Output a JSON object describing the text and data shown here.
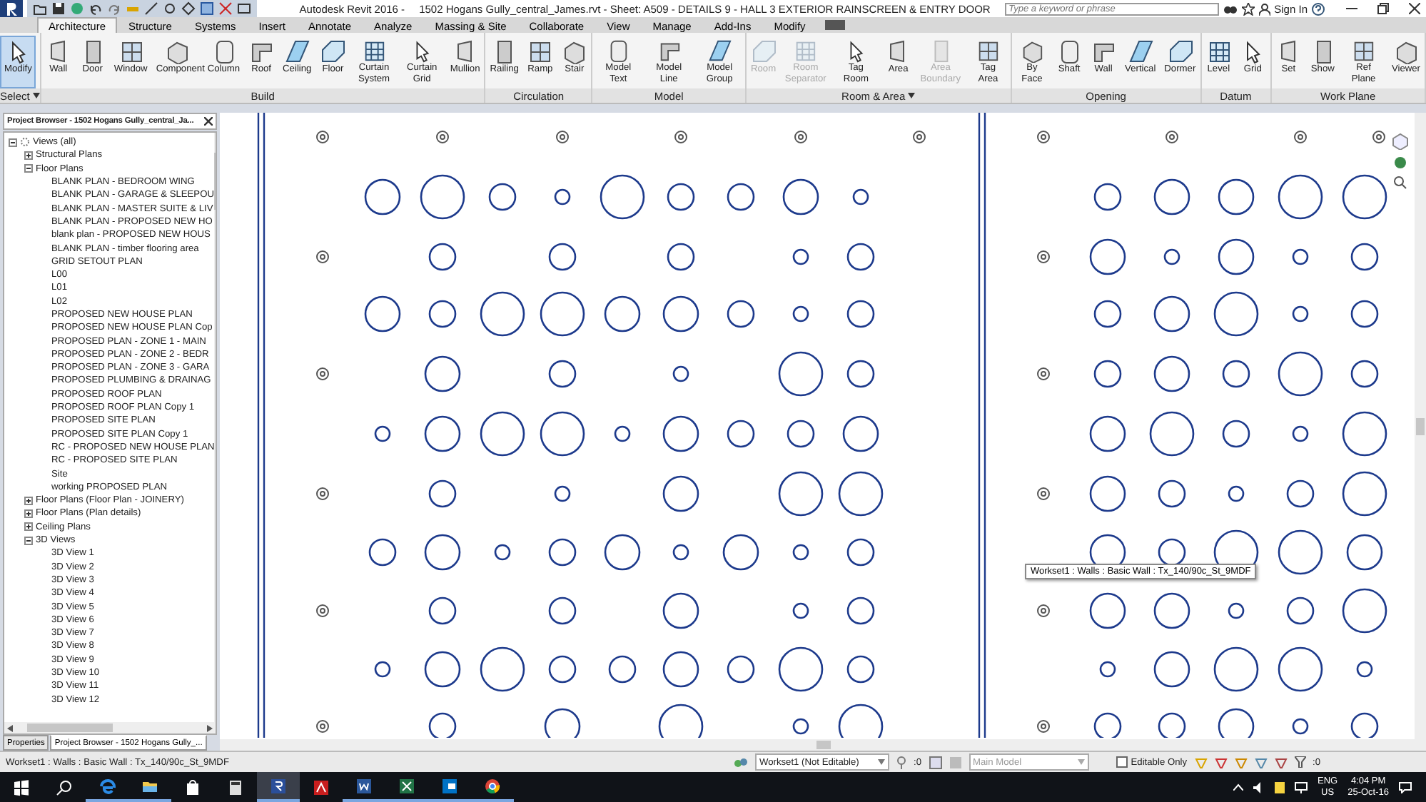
{
  "window": {
    "title": "Autodesk Revit 2016 -",
    "document": "1502 Hogans Gully_central_James.rvt - Sheet: A509 - DETAILS 9 - HALL 3 EXTERIOR RAINSCREEN & ENTRY DOOR",
    "search": {
      "placeholder": "Type a keyword or phrase"
    },
    "sign_in": "Sign In"
  },
  "ribbon": {
    "tabs": [
      {
        "label": "Architecture",
        "selected": true
      },
      {
        "label": "Structure",
        "selected": false
      },
      {
        "label": "Systems",
        "selected": false
      },
      {
        "label": "Insert",
        "selected": false
      },
      {
        "label": "Annotate",
        "selected": false
      },
      {
        "label": "Analyze",
        "selected": false
      },
      {
        "label": "Massing & Site",
        "selected": false
      },
      {
        "label": "Collaborate",
        "selected": false
      },
      {
        "label": "View",
        "selected": false
      },
      {
        "label": "Manage",
        "selected": false
      },
      {
        "label": "Add-Ins",
        "selected": false
      },
      {
        "label": "Modify",
        "selected": false
      }
    ],
    "panels": [
      {
        "label": "Select",
        "menu": true,
        "tools": [
          {
            "label": "Modify",
            "selected": true,
            "disabled": false
          }
        ]
      },
      {
        "label": "Build",
        "menu": false,
        "tools": [
          {
            "label": "Wall",
            "selected": false,
            "disabled": false
          },
          {
            "label": "Door",
            "selected": false,
            "disabled": false
          },
          {
            "label": "Window",
            "selected": false,
            "disabled": false
          },
          {
            "label": "Component",
            "selected": false,
            "disabled": false
          },
          {
            "label": "Column",
            "selected": false,
            "disabled": false
          },
          {
            "label": "Roof",
            "selected": false,
            "disabled": false
          },
          {
            "label": "Ceiling",
            "selected": false,
            "disabled": false
          },
          {
            "label": "Floor",
            "selected": false,
            "disabled": false
          },
          {
            "label": "Curtain System",
            "selected": false,
            "disabled": false
          },
          {
            "label": "Curtain Grid",
            "selected": false,
            "disabled": false
          },
          {
            "label": "Mullion",
            "selected": false,
            "disabled": false
          }
        ]
      },
      {
        "label": "Circulation",
        "menu": false,
        "tools": [
          {
            "label": "Railing",
            "selected": false,
            "disabled": false
          },
          {
            "label": "Ramp",
            "selected": false,
            "disabled": false
          },
          {
            "label": "Stair",
            "selected": false,
            "disabled": false
          }
        ]
      },
      {
        "label": "Model",
        "menu": false,
        "tools": [
          {
            "label": "Model Text",
            "selected": false,
            "disabled": false
          },
          {
            "label": "Model Line",
            "selected": false,
            "disabled": false
          },
          {
            "label": "Model Group",
            "selected": false,
            "disabled": false
          }
        ]
      },
      {
        "label": "Room & Area",
        "menu": true,
        "tools": [
          {
            "label": "Room",
            "selected": false,
            "disabled": true
          },
          {
            "label": "Room Separator",
            "selected": false,
            "disabled": true
          },
          {
            "label": "Tag Room",
            "selected": false,
            "disabled": false
          },
          {
            "label": "Area",
            "selected": false,
            "disabled": false
          },
          {
            "label": "Area Boundary",
            "selected": false,
            "disabled": true
          },
          {
            "label": "Tag Area",
            "selected": false,
            "disabled": false
          }
        ]
      },
      {
        "label": "Opening",
        "menu": false,
        "tools": [
          {
            "label": "By Face",
            "selected": false,
            "disabled": false
          },
          {
            "label": "Shaft",
            "selected": false,
            "disabled": false
          },
          {
            "label": "Wall",
            "selected": false,
            "disabled": false
          },
          {
            "label": "Vertical",
            "selected": false,
            "disabled": false
          },
          {
            "label": "Dormer",
            "selected": false,
            "disabled": false
          }
        ]
      },
      {
        "label": "Datum",
        "menu": false,
        "tools": [
          {
            "label": "Level",
            "selected": false,
            "disabled": false
          },
          {
            "label": "Grid",
            "selected": false,
            "disabled": false
          }
        ]
      },
      {
        "label": "Work Plane",
        "menu": false,
        "tools": [
          {
            "label": "Set",
            "selected": false,
            "disabled": false
          },
          {
            "label": "Show",
            "selected": false,
            "disabled": false
          },
          {
            "label": "Ref Plane",
            "selected": false,
            "disabled": false
          },
          {
            "label": "Viewer",
            "selected": false,
            "disabled": false
          }
        ]
      }
    ]
  },
  "project_browser": {
    "title": "Project Browser - 1502 Hogans Gully_central_Ja...",
    "tree": [
      {
        "label": "Views (all)",
        "expanded": true,
        "children": [
          {
            "label": "Structural Plans",
            "expanded": false
          },
          {
            "label": "Floor Plans",
            "expanded": true,
            "children": [
              {
                "label": "BLANK PLAN - BEDROOM WING"
              },
              {
                "label": "BLANK PLAN - GARAGE & SLEEPOU"
              },
              {
                "label": "BLANK PLAN - MASTER SUITE & LIV"
              },
              {
                "label": "BLANK PLAN - PROPOSED NEW HO"
              },
              {
                "label": "blank plan - PROPOSED NEW HOUS"
              },
              {
                "label": "BLANK PLAN - timber flooring area"
              },
              {
                "label": "GRID SETOUT PLAN"
              },
              {
                "label": "L00"
              },
              {
                "label": "L01"
              },
              {
                "label": "L02"
              },
              {
                "label": "PROPOSED NEW HOUSE PLAN"
              },
              {
                "label": "PROPOSED NEW HOUSE PLAN Cop"
              },
              {
                "label": "PROPOSED PLAN - ZONE 1 - MAIN"
              },
              {
                "label": "PROPOSED PLAN - ZONE 2 - BEDR"
              },
              {
                "label": "PROPOSED PLAN - ZONE 3 - GARA"
              },
              {
                "label": "PROPOSED PLUMBING & DRAINAG"
              },
              {
                "label": "PROPOSED ROOF PLAN"
              },
              {
                "label": "PROPOSED ROOF PLAN Copy 1"
              },
              {
                "label": "PROPOSED SITE PLAN"
              },
              {
                "label": "PROPOSED SITE PLAN Copy 1"
              },
              {
                "label": "RC - PROPOSED NEW HOUSE PLAN"
              },
              {
                "label": "RC - PROPOSED SITE PLAN"
              },
              {
                "label": "Site"
              },
              {
                "label": "working PROPOSED PLAN"
              }
            ]
          },
          {
            "label": "Floor Plans (Floor Plan - JOINERY)",
            "expanded": false
          },
          {
            "label": "Floor Plans (Plan details)",
            "expanded": false
          },
          {
            "label": "Ceiling Plans",
            "expanded": false
          },
          {
            "label": "3D Views",
            "expanded": true,
            "children": [
              {
                "label": "3D View 1"
              },
              {
                "label": "3D View 2"
              },
              {
                "label": "3D View 3"
              },
              {
                "label": "3D View 4"
              },
              {
                "label": "3D View 5"
              },
              {
                "label": "3D View 6"
              },
              {
                "label": "3D View 7"
              },
              {
                "label": "3D View 8"
              },
              {
                "label": "3D View 9"
              },
              {
                "label": "3D View 10"
              },
              {
                "label": "3D View 11"
              },
              {
                "label": "3D View 12"
              }
            ]
          }
        ]
      }
    ],
    "tabs": [
      {
        "label": "Properties",
        "selected": false
      },
      {
        "label": "Project Browser - 1502 Hogans Gully_...",
        "selected": true
      }
    ]
  },
  "canvas": {
    "tooltip": "Workset1 : Walls : Basic Wall : Tx_140/90c_St_9MDF"
  },
  "status_bar": {
    "message": "Workset1 : Walls : Basic Wall : Tx_140/90c_St_9MDF",
    "workset": "Workset1 (Not Editable)",
    "selection_count": ":0",
    "design_option": "Main Model",
    "editable_only": {
      "label": "Editable Only",
      "checked": false
    },
    "filter_count": ":0"
  },
  "taskbar": {
    "language": "ENG",
    "region": "US",
    "time": "4:04 PM",
    "date": "25-Oct-16"
  }
}
